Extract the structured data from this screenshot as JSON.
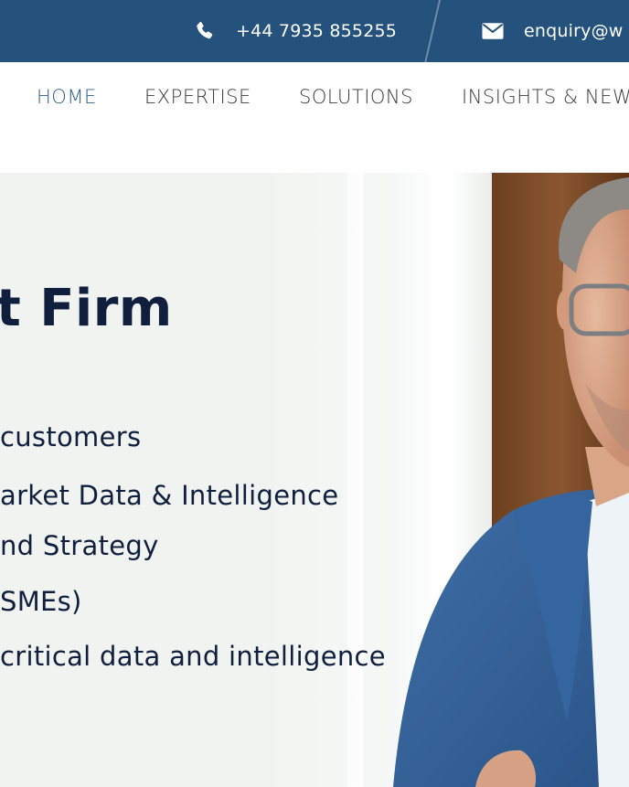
{
  "topbar": {
    "phone": {
      "icon": "phone-icon",
      "text": "+44 7935 855255"
    },
    "email": {
      "icon": "envelope-icon",
      "text": "enquiry@w"
    }
  },
  "nav": {
    "items": [
      {
        "label": "HOME",
        "active": true
      },
      {
        "label": "EXPERTISE",
        "active": false
      },
      {
        "label": "SOLUTIONS",
        "active": false
      },
      {
        "label": "INSIGHTS & NEW",
        "active": false
      }
    ]
  },
  "hero": {
    "title": "t Firm",
    "lines": [
      "customers",
      "arket Data & Intelligence",
      "nd Strategy",
      "SMEs)",
      "critical data and intelligence"
    ]
  },
  "colors": {
    "topbar_bg": "#24527d",
    "nav_active": "#2f5c88",
    "nav_text": "#3a3a3a",
    "hero_text": "#0f1f3d",
    "hero_bg": "#f1f3f1"
  }
}
